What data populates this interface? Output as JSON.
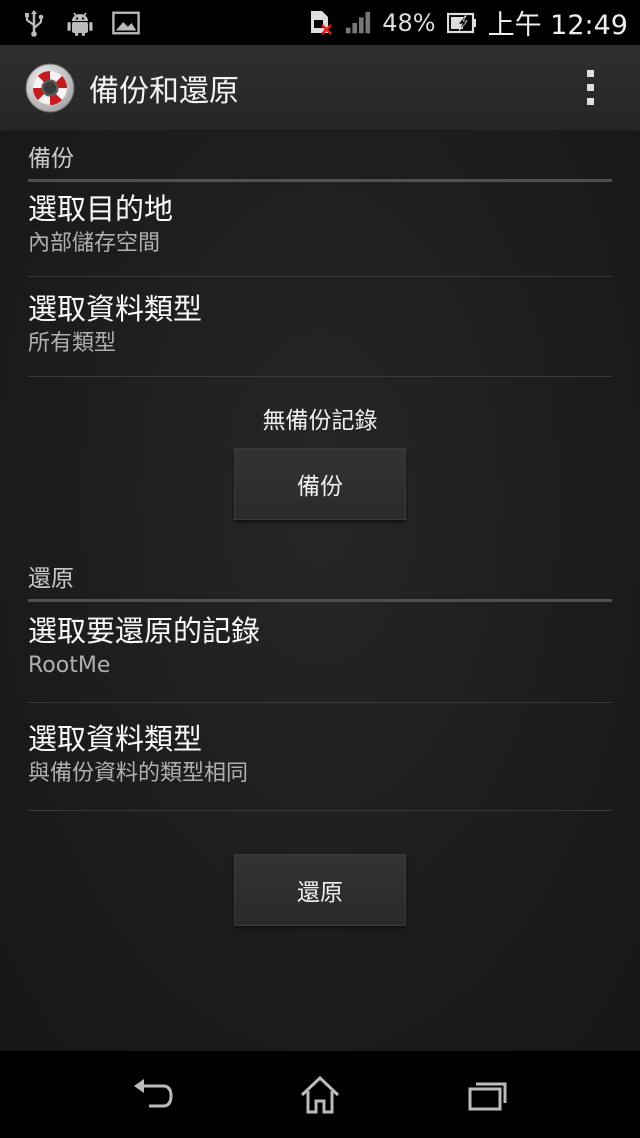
{
  "status_bar": {
    "battery_percent": "48%",
    "time": "上午 12:49",
    "icons_left": [
      "usb-icon",
      "android-debug-icon",
      "image-icon"
    ],
    "icons_right": [
      "sim-error-icon",
      "signal-icon",
      "battery-charging-icon"
    ]
  },
  "app_bar": {
    "title": "備份和還原",
    "logo_icon": "lifebuoy-app-icon",
    "menu_icon": "overflow-menu-icon"
  },
  "backup": {
    "header": "備份",
    "destination": {
      "title": "選取目的地",
      "summary": "內部儲存空間"
    },
    "data_type": {
      "title": "選取資料類型",
      "summary": "所有類型"
    },
    "status": "無備份記錄",
    "button_label": "備份"
  },
  "restore": {
    "header": "還原",
    "record": {
      "title": "選取要還原的記錄",
      "summary": "RootMe"
    },
    "data_type": {
      "title": "選取資料類型",
      "summary": "與備份資料的類型相同"
    },
    "button_label": "還原"
  },
  "nav_bar": {
    "icons": [
      "back-icon",
      "home-icon",
      "recent-apps-icon"
    ]
  }
}
